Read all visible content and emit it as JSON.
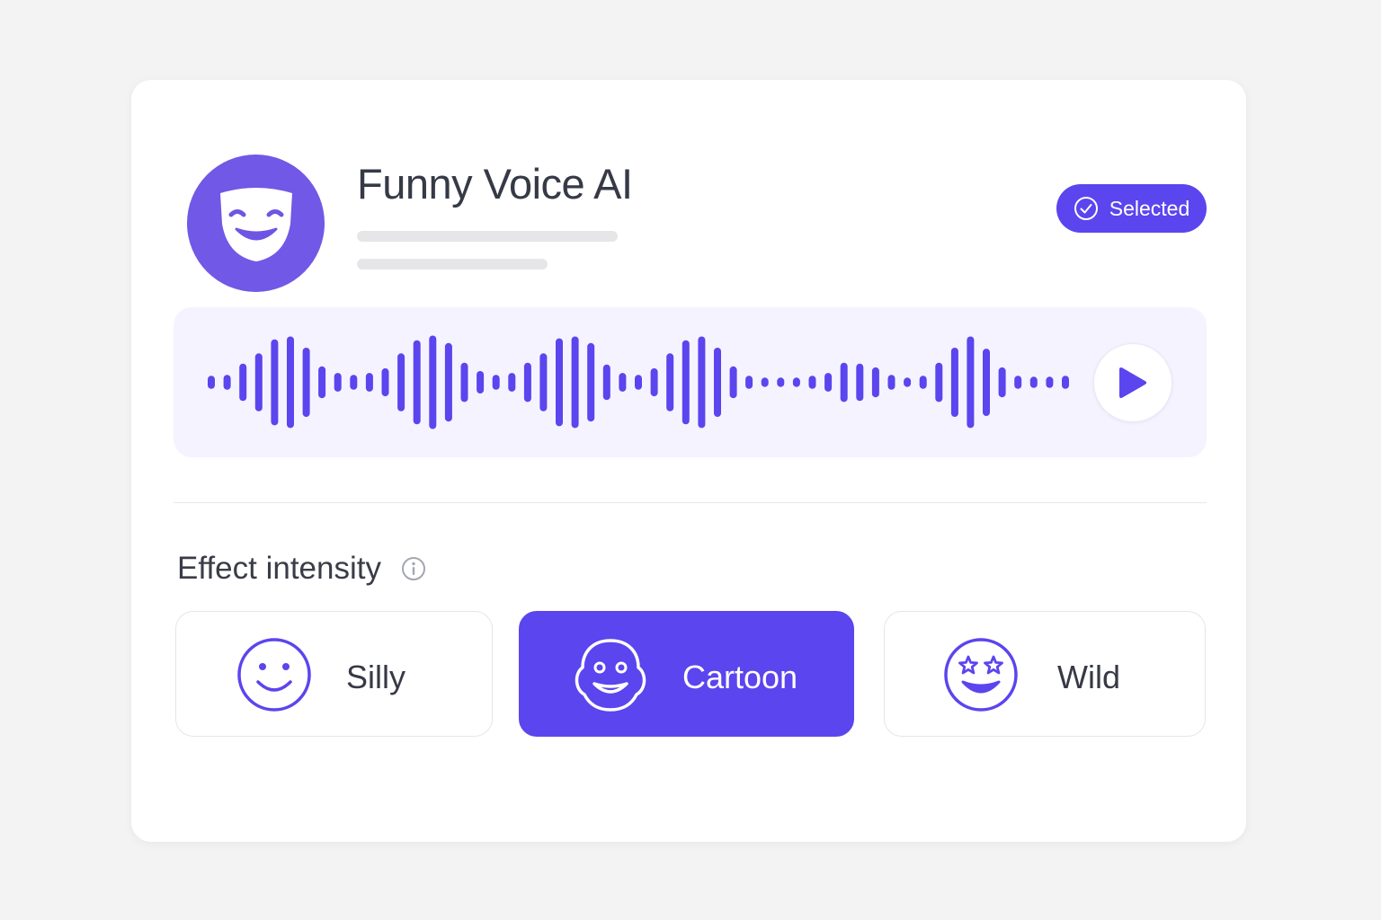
{
  "app": {
    "title": "Funny Voice AI"
  },
  "badge": {
    "label": "Selected"
  },
  "effect": {
    "label": "Effect intensity",
    "options": [
      {
        "label": "Silly",
        "selected": false
      },
      {
        "label": "Cartoon",
        "selected": true
      },
      {
        "label": "Wild",
        "selected": false
      }
    ]
  },
  "colors": {
    "accent": "#5b45ee",
    "avatar": "#7158e6",
    "wave": "#5b45ee",
    "panel": "#f5f3ff"
  },
  "icons": {
    "avatar": "theater-mask-icon",
    "badge": "check-circle-icon",
    "play": "play-icon",
    "info": "info-icon",
    "silly": "smiley-face-icon",
    "cartoon": "cartoon-face-icon",
    "wild": "star-eyes-face-icon"
  },
  "waveform": {
    "levels": [
      0.14,
      0.16,
      0.4,
      0.62,
      0.92,
      0.98,
      0.74,
      0.34,
      0.2,
      0.16,
      0.2,
      0.3,
      0.62,
      0.9,
      1.0,
      0.84,
      0.42,
      0.24,
      0.16,
      0.2,
      0.42,
      0.62,
      0.94,
      0.98,
      0.84,
      0.38,
      0.2,
      0.16,
      0.3,
      0.62,
      0.9,
      0.98,
      0.74,
      0.34,
      0.14,
      0.1,
      0.1,
      0.1,
      0.14,
      0.2,
      0.42,
      0.4,
      0.32,
      0.16,
      0.1,
      0.14,
      0.42,
      0.74,
      0.98,
      0.72,
      0.32,
      0.14,
      0.12,
      0.12,
      0.14
    ]
  }
}
